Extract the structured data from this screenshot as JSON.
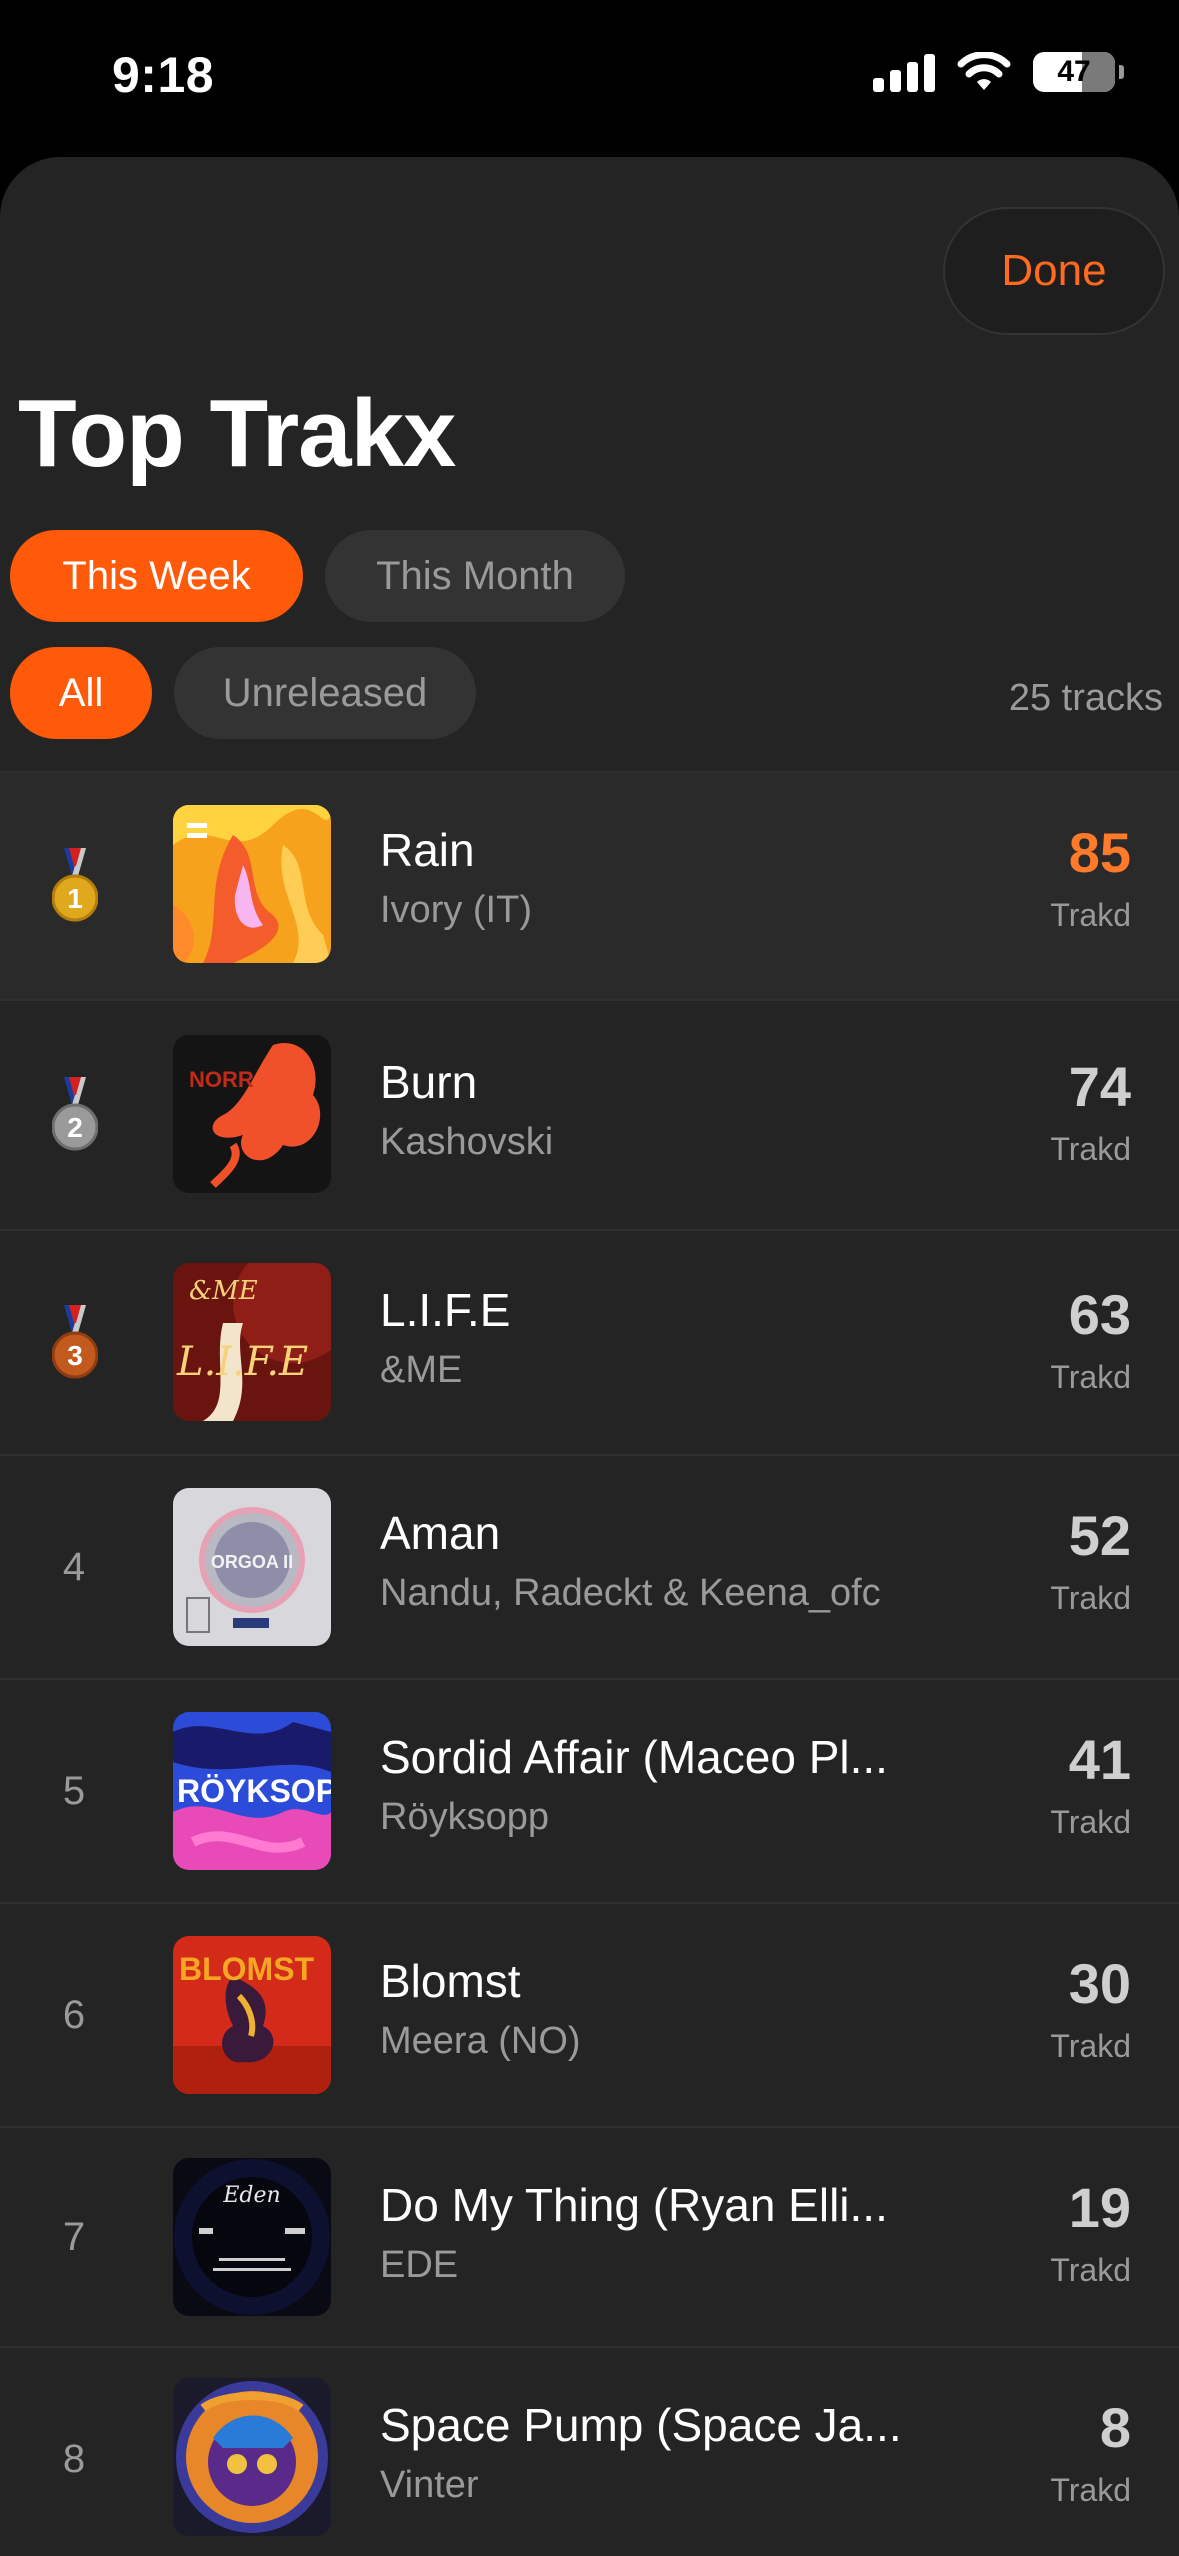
{
  "status_bar": {
    "time": "9:18",
    "battery": "47"
  },
  "header": {
    "done_label": "Done",
    "title": "Top Trakx"
  },
  "period_tabs": [
    {
      "label": "This Week",
      "active": true
    },
    {
      "label": "This Month",
      "active": false
    }
  ],
  "filter_tabs": [
    {
      "label": "All",
      "active": true
    },
    {
      "label": "Unreleased",
      "active": false
    }
  ],
  "track_count": "25 tracks",
  "tracks": [
    {
      "rank": "1",
      "title": "Rain",
      "artist": "Ivory (IT)",
      "score": "85",
      "score_label": "Trakd"
    },
    {
      "rank": "2",
      "title": "Burn",
      "artist": "Kashovski",
      "score": "74",
      "score_label": "Trakd"
    },
    {
      "rank": "3",
      "title": "L.I.F.E",
      "artist": "&ME",
      "score": "63",
      "score_label": "Trakd"
    },
    {
      "rank": "4",
      "title": "Aman",
      "artist": "Nandu, Radeckt & Keena_ofc",
      "score": "52",
      "score_label": "Trakd"
    },
    {
      "rank": "5",
      "title": "Sordid Affair (Maceo Pl...",
      "artist": "Röyksopp",
      "score": "41",
      "score_label": "Trakd"
    },
    {
      "rank": "6",
      "title": "Blomst",
      "artist": "Meera (NO)",
      "score": "30",
      "score_label": "Trakd"
    },
    {
      "rank": "7",
      "title": "Do My Thing (Ryan Elli...",
      "artist": "EDE",
      "score": "19",
      "score_label": "Trakd"
    },
    {
      "rank": "8",
      "title": "Space Pump (Space Ja...",
      "artist": "Vinter",
      "score": "8",
      "score_label": "Trakd"
    }
  ],
  "cover_art_text": {
    "burn": "NORR",
    "life_top": "&ME",
    "life_main": "L.I.F.E",
    "aman": "ORGOA II",
    "royksopp": "RÖYKSOPP",
    "blomst": "BLOMST",
    "ede": "Eden"
  },
  "colors": {
    "accent": "#ff5a0a",
    "sheet_bg": "#242424",
    "gold": "#e0a81c",
    "silver": "#9a9a9a",
    "bronze": "#c25a1e"
  }
}
